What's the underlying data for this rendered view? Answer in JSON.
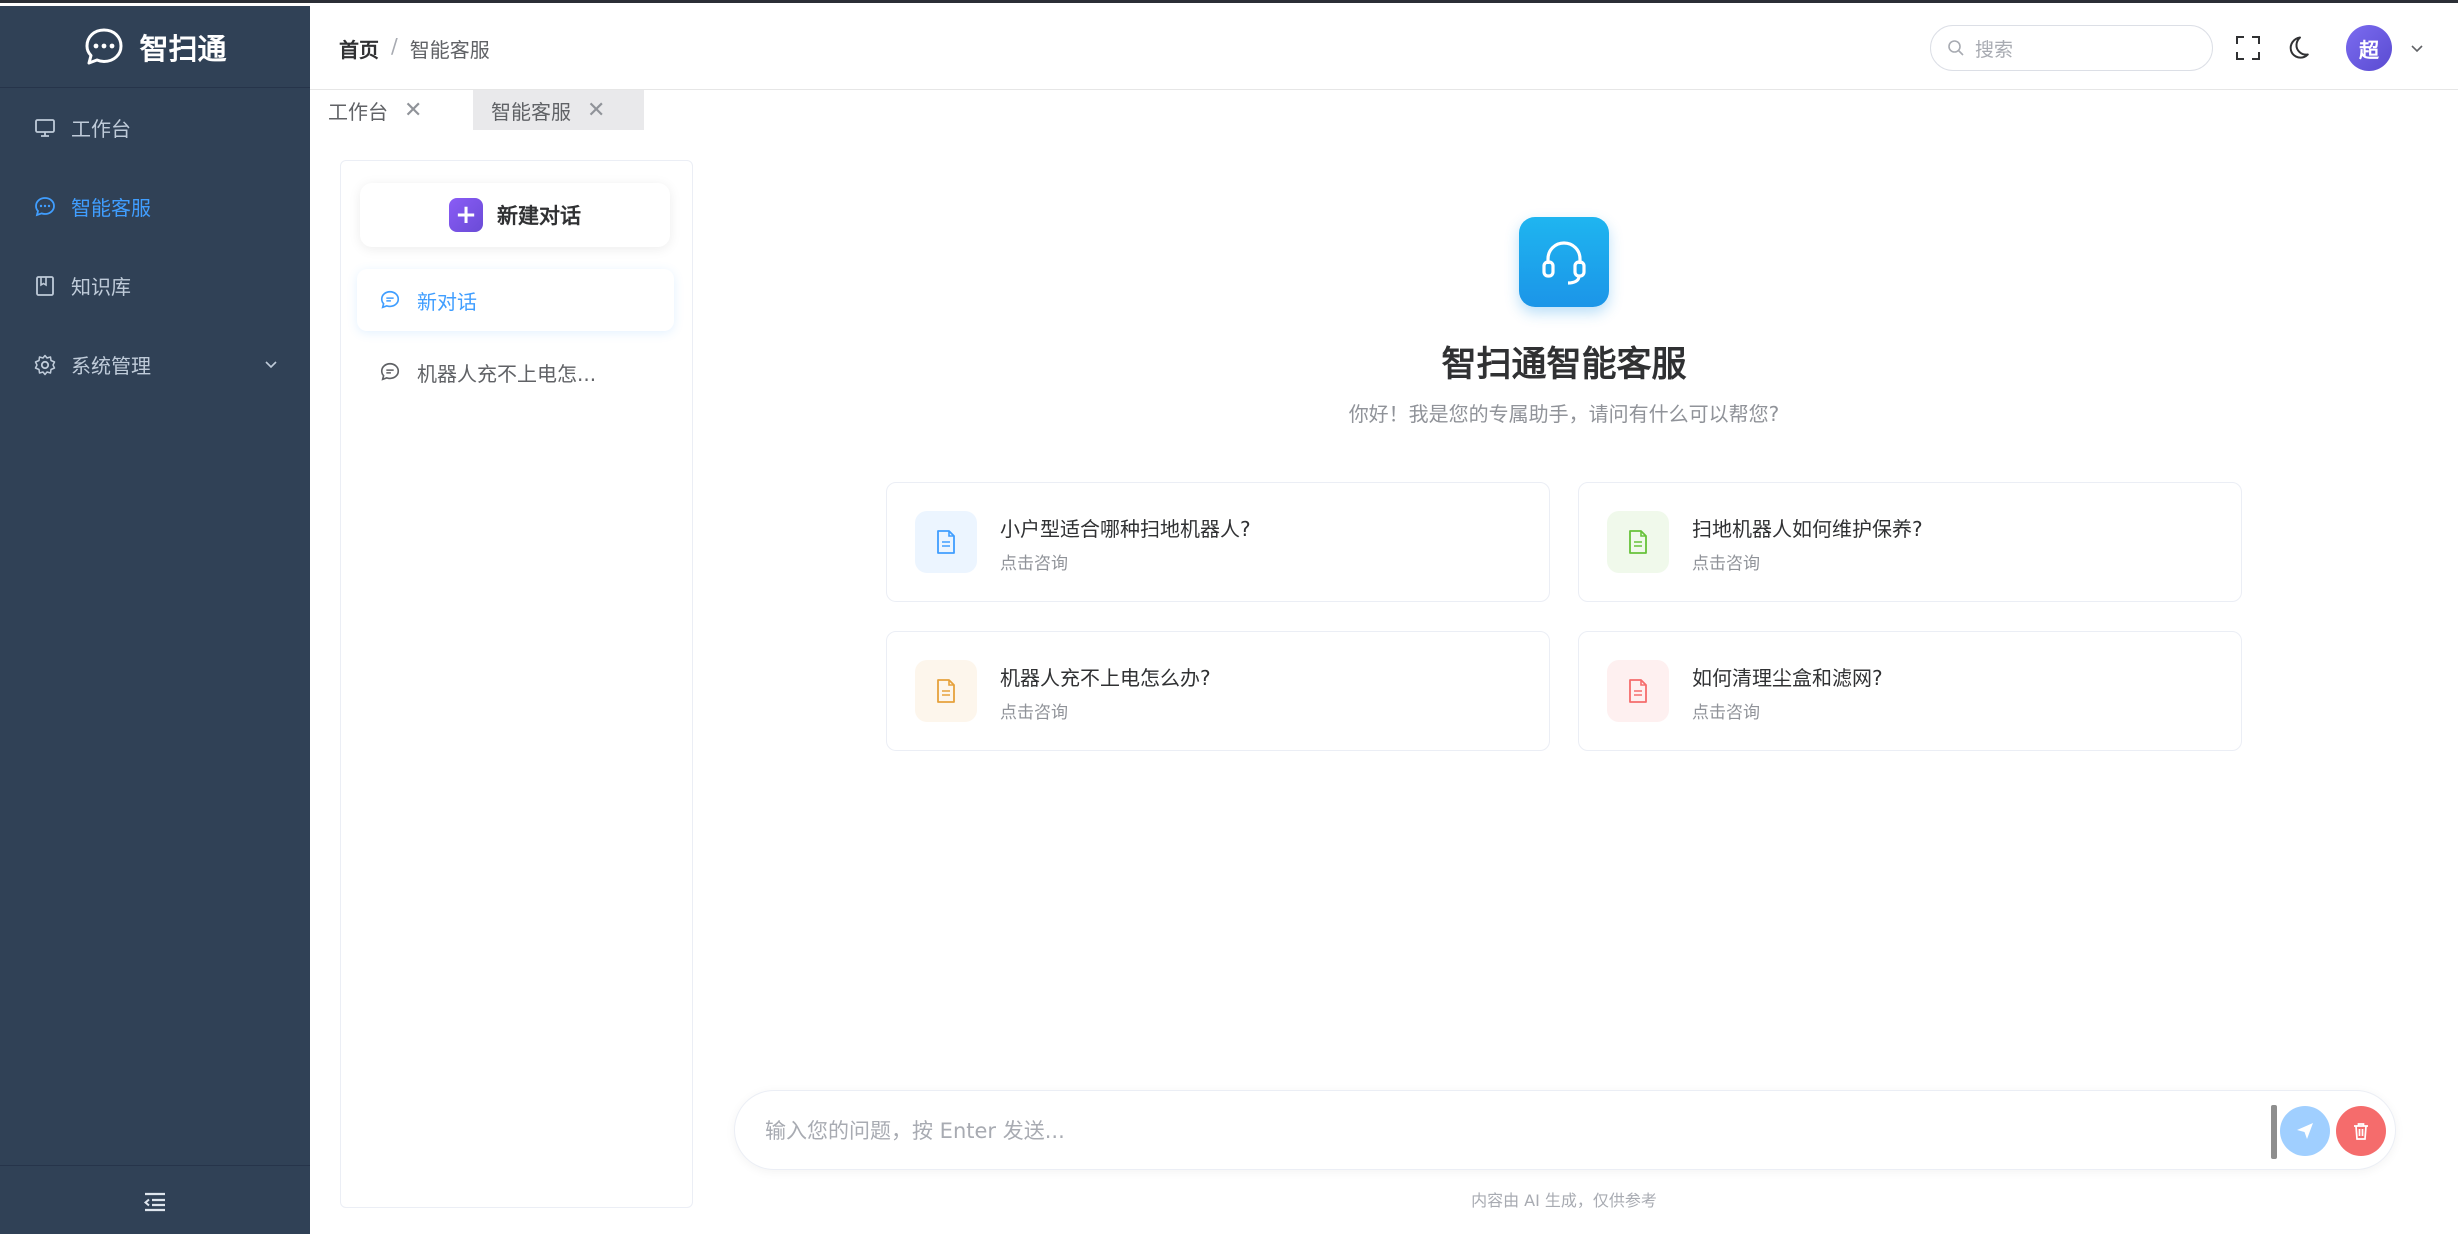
{
  "app": {
    "title": "智扫通"
  },
  "sidebar": {
    "items": [
      {
        "label": "工作台",
        "icon": "monitor-icon"
      },
      {
        "label": "智能客服",
        "icon": "chat-icon",
        "active": true
      },
      {
        "label": "知识库",
        "icon": "book-icon"
      },
      {
        "label": "系统管理",
        "icon": "gear-icon"
      }
    ]
  },
  "header": {
    "breadcrumb": {
      "home": "首页",
      "separator": "/",
      "current": "智能客服"
    },
    "search_placeholder": "搜索",
    "avatar_text": "超"
  },
  "tabs": [
    {
      "label": "工作台",
      "close": "✕"
    },
    {
      "label": "智能客服",
      "close": "✕",
      "active": true
    }
  ],
  "conversations": {
    "new_button": "新建对话",
    "new_button_icon": "+",
    "items": [
      {
        "label": "新对话",
        "active": true
      },
      {
        "label": "机器人充不上电怎..."
      }
    ]
  },
  "main": {
    "title": "智扫通智能客服",
    "subtitle": "你好！我是您的专属助手，请问有什么可以帮您?",
    "cards": [
      {
        "title": "小户型适合哪种扫地机器人?",
        "sub": "点击咨询",
        "color": "#409eff",
        "bg": "#ecf5ff"
      },
      {
        "title": "扫地机器人如何维护保养?",
        "sub": "点击咨询",
        "color": "#67c23a",
        "bg": "#f0f9eb"
      },
      {
        "title": "机器人充不上电怎么办?",
        "sub": "点击咨询",
        "color": "#e6a23c",
        "bg": "#fdf6ec"
      },
      {
        "title": "如何清理尘盒和滤网?",
        "sub": "点击咨询",
        "color": "#f56c6c",
        "bg": "#fef0f0"
      }
    ],
    "input_placeholder": "输入您的问题，按 Enter 发送...",
    "disclaimer": "内容由 AI 生成，仅供参考"
  },
  "colors": {
    "sidebar_bg": "#304156",
    "accent": "#409eff",
    "send": "#a0cfff",
    "delete": "#f56c6c"
  }
}
